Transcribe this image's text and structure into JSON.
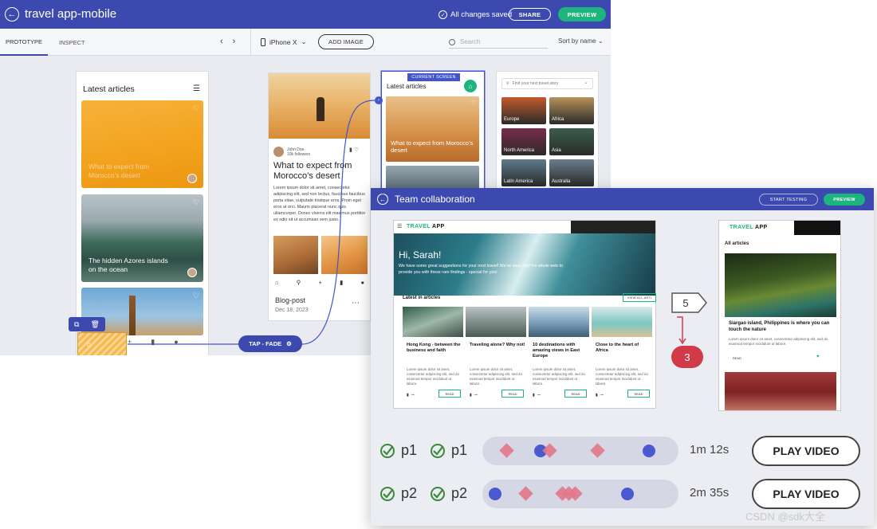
{
  "app": {
    "title": "travel app-mobile",
    "saved_status": "All changes saved",
    "share_label": "SHARE",
    "preview_label": "PREVIEW"
  },
  "left_panel": {
    "tabs": [
      "PROTOTYPE",
      "INSPECT"
    ]
  },
  "toolbar": {
    "device": "iPhone X",
    "add_image_label": "ADD IMAGE",
    "search_placeholder": "Search",
    "sort_label": "Sort by name"
  },
  "screen1": {
    "heading": "Latest articles",
    "cards": [
      {
        "caption": "What to expect from Morocco’s desert"
      },
      {
        "caption": "The hidden Azores islands on the ocean"
      },
      {
        "caption": ""
      }
    ]
  },
  "interaction": {
    "label": "TAP - FADE"
  },
  "screen2": {
    "author": "John Doe",
    "followers": "10k followers",
    "title": "What to expect from Morocco’s desert",
    "body": "Lorem ipsum dolor sit amet, consectetur adipiscing elit, sed non lectus, faucibus faucibus porta vitae, vulputate tristique eros. Proin eget eros at orci. Mauris placerat nunc quis ullamcorper. Donec viverra elit maximus porttitor ex odio sit ut accumsan sem justo.",
    "label": "Blog-post",
    "date": "Dec 18, 2023"
  },
  "screen3": {
    "badge": "CURRENT SCREEN",
    "heading": "Latest articles",
    "card_caption": "What to expect from Morocco’s desert"
  },
  "screen4": {
    "search_placeholder": "Find your next travel story",
    "tiles": [
      "Europe",
      "Africa",
      "North America",
      "Asia",
      "Latin America",
      "Australia"
    ],
    "tile_colors": [
      "#c45a2c",
      "#b7925a",
      "#7a2b4a",
      "#3b5e4c",
      "#5e7a8a",
      "#6a7c8c"
    ]
  },
  "collab": {
    "title": "Team collaboration",
    "start_testing_label": "START TESTING",
    "preview_label": "PREVIEW",
    "site": {
      "brand_a": "TRAVEL",
      "brand_b": "APP",
      "greeting": "Hi, Sarah!",
      "subtext": "We have some great suggestions for your next travel! We’ve searched the whole web to provide you with these rare findings - special for you!",
      "section": "Latest in articles",
      "view_all": "VIEW ALL ARTI",
      "articles": [
        {
          "title": "Hong Kong - between the business and faith",
          "text": "Lorem ipsum dolor sit amet, consectetur adipiscing elit, sed do eiusmod tempor incididunt ut labore.",
          "read": "READ",
          "color": "#2f5e4a"
        },
        {
          "title": "Traveling alone? Why not!",
          "text": "Lorem ipsum dolor sit amet, consectetur adipiscing elit, sed do eiusmod tempor incididunt ut labore.",
          "read": "READ",
          "color": "#8a8f7a"
        },
        {
          "title": "10 destinations with amazing views in East Europe",
          "text": "Lorem ipsum dolor sit amet, consectetur adipiscing elit, sed do eiusmod tempor incididunt ut labore.",
          "read": "READ",
          "color": "#6f8fa6"
        },
        {
          "title": "Close to the heart of Africa",
          "text": "Lorem ipsum dolor sit amet, consectetur adipiscing elit, sed do eiusmod tempor incididunt ut labore.",
          "read": "READ",
          "color": "#7cc6c2"
        }
      ]
    },
    "mobile": {
      "brand_a": "TRAVEL",
      "brand_b": "APP",
      "heading": "All articles",
      "title": "Siargao island, Philippines is where you can touch the nature",
      "text": "Lorem ipsum dolor sit amet, consectetur adipiscing elit, sed do eiusmod tempor incididunt ut labore.",
      "read": "READ"
    },
    "step_from": "5",
    "step_to": "3",
    "participants": [
      {
        "a": "p1",
        "b": "p1",
        "duration": "1m 12s",
        "play": "PLAY VIDEO"
      },
      {
        "a": "p2",
        "b": "p2",
        "duration": "2m 35s",
        "play": "PLAY VIDEO"
      }
    ]
  },
  "watermark": "CSDN @sdk大全"
}
